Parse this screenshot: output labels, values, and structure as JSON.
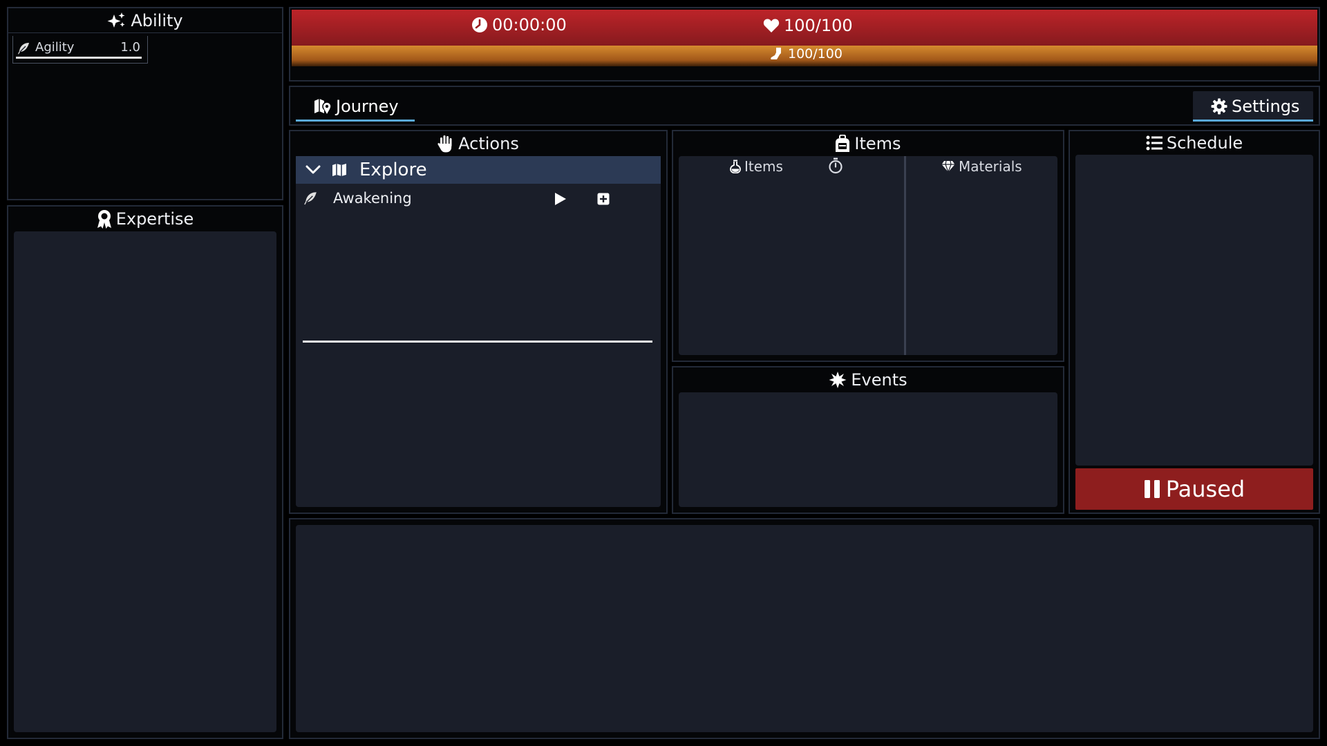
{
  "ability": {
    "title": "Ability",
    "items": [
      {
        "label": "Agility",
        "value": "1.0",
        "icon": "feather-icon"
      }
    ]
  },
  "expertise": {
    "title": "Expertise"
  },
  "stats": {
    "time": "00:00:00",
    "health": "100/100",
    "stamina": "100/100",
    "health_fill": 1.0,
    "stamina_fill": 1.0
  },
  "tabs": {
    "journey_label": "Journey",
    "settings_label": "Settings"
  },
  "actions": {
    "title": "Actions",
    "categories": [
      {
        "label": "Explore",
        "expanded": true,
        "items": [
          {
            "label": "Awakening",
            "progress": 1.0
          }
        ]
      }
    ]
  },
  "items": {
    "title": "Items",
    "items_col_label": "Items",
    "materials_col_label": "Materials"
  },
  "events": {
    "title": "Events"
  },
  "schedule": {
    "title": "Schedule",
    "paused_label": "Paused"
  },
  "colors": {
    "health": "#bd2429",
    "stamina": "#d58a2f",
    "paused": "#8e1e1e",
    "tab_accent": "#5aa9d8",
    "category_bg": "#2c3a55",
    "panel_bg": "#1a1e29"
  }
}
